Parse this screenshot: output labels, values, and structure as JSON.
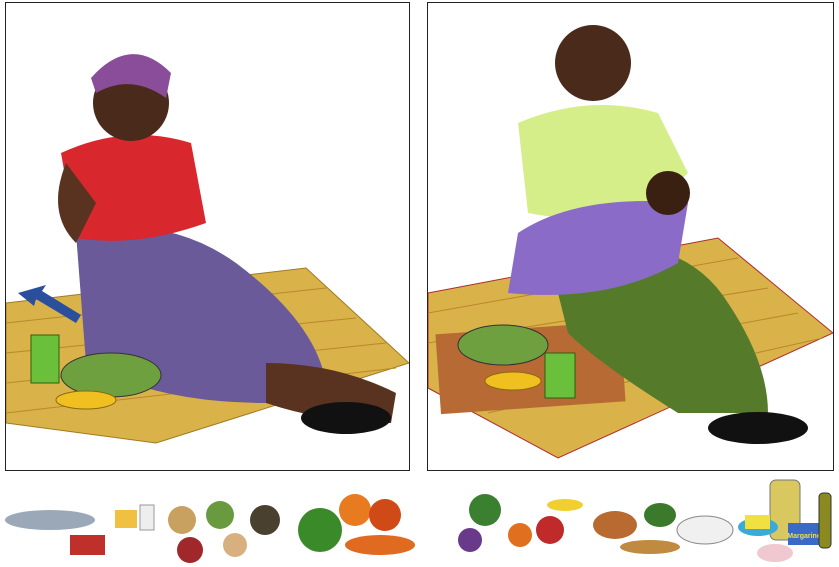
{
  "panels": [
    {
      "scene": "pregnant-woman-eating",
      "colors": {
        "dress": "#d8282e",
        "skirt": "#6a5a9a",
        "mat": "#d9b24a",
        "arrow": "#2a4f9c"
      }
    },
    {
      "scene": "breastfeeding-woman-eating",
      "colors": {
        "shirt": "#d6ee8a",
        "skirt": "#557a2a",
        "wrap": "#8a6cc8",
        "mat": "#d9b24a"
      }
    }
  ],
  "food_groups": [
    "animal-source-foods",
    "legumes-and-nuts",
    "vegetables",
    "fruits",
    "staples",
    "fats-and-oils"
  ],
  "margarine_label": "Margarine"
}
